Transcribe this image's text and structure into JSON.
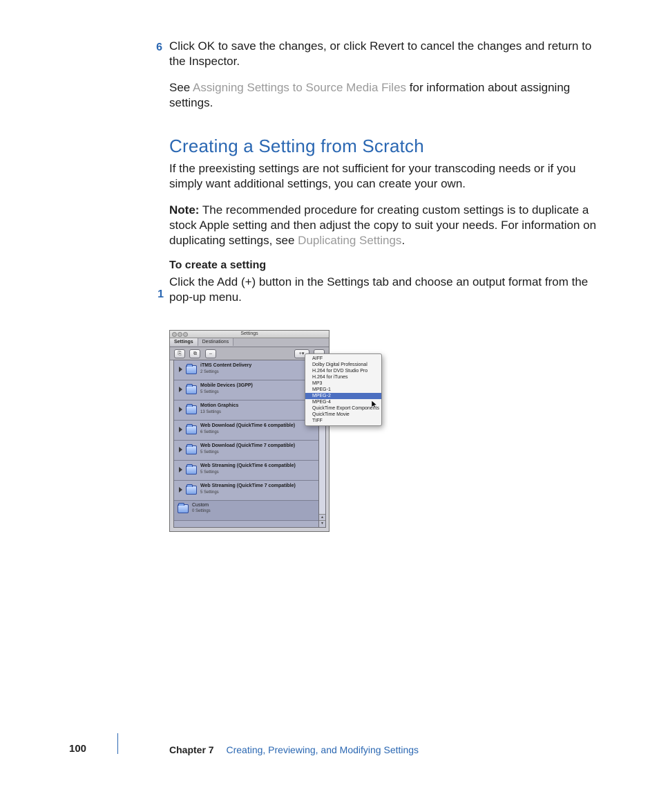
{
  "step6": {
    "num": "6",
    "text_a": "Click OK to save the changes, or click Revert to cancel the changes and return to the Inspector.",
    "text_b_pre": "See ",
    "text_b_link": "Assigning Settings to Source Media Files",
    "text_b_post": " for information about assigning settings."
  },
  "section": {
    "heading": "Creating a Setting from Scratch",
    "intro": "If the preexisting settings are not sufficient for your transcoding needs or if you simply want additional settings, you can create your own.",
    "note_label": "Note:",
    "note_body_a": "  The recommended procedure for creating custom settings is to duplicate a stock Apple setting and then adjust the copy to suit your needs. For information on duplicating settings, see ",
    "note_link": "Duplicating Settings",
    "note_body_b": "."
  },
  "task": {
    "heading": "To create a setting",
    "num": "1",
    "text": "Click the Add (+) button in the Settings tab and choose an output format from the pop-up menu."
  },
  "shot": {
    "title": "Settings",
    "tab1": "Settings",
    "tab2": "Destinations",
    "btn_dup": "⎘",
    "btn_grp": "⧉",
    "btn_del": "–",
    "btn_add": "+▾",
    "btn_minus": "–",
    "rows": [
      {
        "label": "iTMS Content Delivery",
        "sub": "2 Settings"
      },
      {
        "label": "Mobile Devices (3GPP)",
        "sub": "5 Settings"
      },
      {
        "label": "Motion Graphics",
        "sub": "13 Settings"
      },
      {
        "label": "Web Download (QuickTime 6 compatible)",
        "sub": "6 Settings"
      },
      {
        "label": "Web Download (QuickTime 7 compatible)",
        "sub": "5 Settings"
      },
      {
        "label": "Web Streaming (QuickTime 6 compatible)",
        "sub": "5 Settings"
      },
      {
        "label": "Web Streaming (QuickTime 7 compatible)",
        "sub": "5 Settings"
      }
    ],
    "custom": {
      "label": "Custom",
      "sub": "0 Settings"
    },
    "menu": [
      "AIFF",
      "Dolby Digital Professional",
      "H.264 for DVD Studio Pro",
      "H.264 for iTunes",
      "MP3",
      "MPEG-1",
      "MPEG-2",
      "MPEG-4",
      "QuickTime Export Components",
      "QuickTime Movie",
      "TIFF"
    ],
    "menu_selected_index": 6
  },
  "footer": {
    "page": "100",
    "chapter": "Chapter 7",
    "title": "Creating, Previewing, and Modifying Settings"
  }
}
